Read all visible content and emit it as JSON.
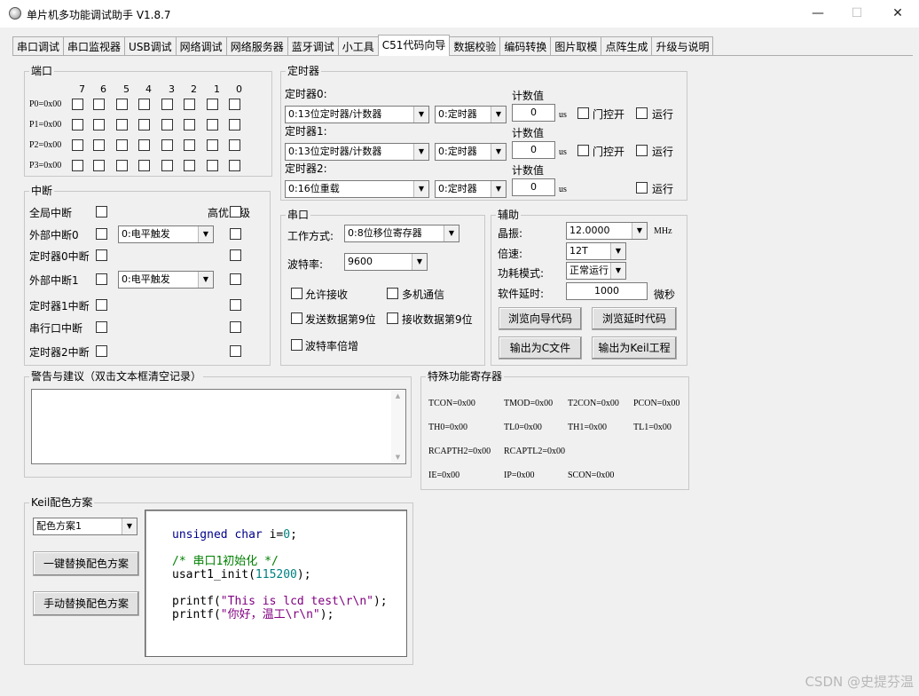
{
  "window": {
    "title": "单片机多功能调试助手 V1.8.7",
    "minimize_glyph": "—",
    "maximize_glyph": "☐",
    "close_glyph": "✕"
  },
  "tabs": [
    "串口调试",
    "串口监视器",
    "USB调试",
    "网络调试",
    "网络服务器",
    "蓝牙调试",
    "小工具",
    "C51代码向导",
    "数据校验",
    "编码转换",
    "图片取模",
    "点阵生成",
    "升级与说明"
  ],
  "active_tab": 7,
  "port": {
    "legend": "端口",
    "bits": [
      "7",
      "6",
      "5",
      "4",
      "3",
      "2",
      "1",
      "0"
    ],
    "rows": [
      "P0=0x00",
      "P1=0x00",
      "P2=0x00",
      "P3=0x00"
    ]
  },
  "interrupt": {
    "legend": "中断",
    "priority_label": "高优先级",
    "rows": [
      {
        "label": "全局中断",
        "combo": null
      },
      {
        "label": "外部中断0",
        "combo": "0:电平触发"
      },
      {
        "label": "定时器0中断",
        "combo": null
      },
      {
        "label": "外部中断1",
        "combo": "0:电平触发"
      },
      {
        "label": "定时器1中断",
        "combo": null
      },
      {
        "label": "串行口中断",
        "combo": null
      },
      {
        "label": "定时器2中断",
        "combo": null
      }
    ]
  },
  "timer": {
    "legend": "定时器",
    "count_label": "计数值",
    "us_label": "us",
    "gate_label": "门控开",
    "run_label": "运行",
    "rows": [
      {
        "label": "定时器0:",
        "mode": "0:13位定时器/计数器",
        "func": "0:定时器",
        "count": "0"
      },
      {
        "label": "定时器1:",
        "mode": "0:13位定时器/计数器",
        "func": "0:定时器",
        "count": "0"
      },
      {
        "label": "定时器2:",
        "mode": "0:16位重载",
        "func": "0:定时器",
        "count": "0"
      }
    ]
  },
  "serial": {
    "legend": "串口",
    "mode_label": "工作方式:",
    "mode_value": "0:8位移位寄存器",
    "baud_label": "波特率:",
    "baud_value": "9600",
    "allow_rx": "允许接收",
    "multi": "多机通信",
    "send9": "发送数据第9位",
    "recv9": "接收数据第9位",
    "double": "波特率倍增"
  },
  "aux": {
    "legend": "辅助",
    "crystal_label": "晶振:",
    "crystal_value": "12.0000",
    "mhz": "MHz",
    "speed_label": "倍速:",
    "speed_value": "12T",
    "power_label": "功耗模式:",
    "power_value": "正常运行",
    "delay_label": "软件延时:",
    "delay_value": "1000",
    "us_cn": "微秒",
    "btn_browse_wizard": "浏览向导代码",
    "btn_browse_delay": "浏览延时代码",
    "btn_export_c": "输出为C文件",
    "btn_export_keil": "输出为Keil工程"
  },
  "warning": {
    "legend": "警告与建议（双击文本框清空记录）"
  },
  "sfr": {
    "legend": "特殊功能寄存器",
    "rows": [
      [
        "TCON=0x00",
        "TMOD=0x00",
        "T2CON=0x00",
        "PCON=0x00"
      ],
      [
        "TH0=0x00",
        "TL0=0x00",
        "TH1=0x00",
        "TL1=0x00"
      ],
      [
        "RCAPTH2=0x00",
        "RCAPTL2=0x00"
      ],
      [
        "IE=0x00",
        "IP=0x00",
        "SCON=0x00"
      ]
    ]
  },
  "keil": {
    "legend": "Keil配色方案",
    "scheme": "配色方案1",
    "btn_one_click": "一键替换配色方案",
    "btn_manual": "手动替换配色方案"
  },
  "code": {
    "l1_kw1": "unsigned",
    "l1_kw2": "char",
    "l1_mid": " i=",
    "l1_num": "0",
    "l1_end": ";",
    "l2_cmt": "/* 串口1初始化 */",
    "l3_a": "usart1_init(",
    "l3_num": "115200",
    "l3_b": ");",
    "l4_a": "printf(",
    "l4_str": "\"This is lcd test\\r\\n\"",
    "l4_b": ");",
    "l5_a": "printf(",
    "l5_str": "\"你好，温工\\r\\n\"",
    "l5_b": ");"
  },
  "watermark": "CSDN @史提芬温"
}
